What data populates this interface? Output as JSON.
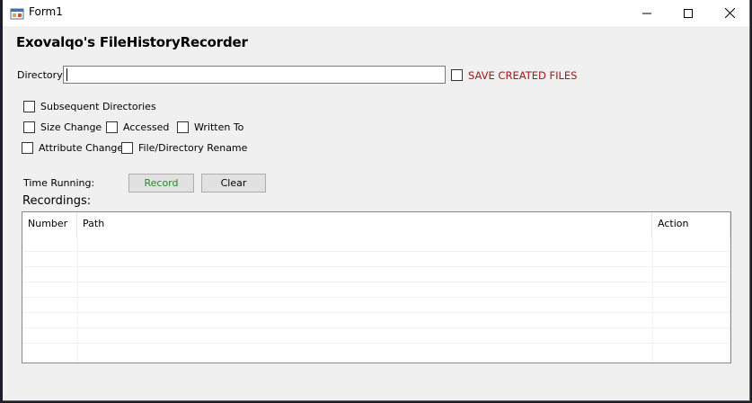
{
  "window": {
    "title": "Form1"
  },
  "app": {
    "heading": "Exovalqo's FileHistoryRecorder"
  },
  "directory": {
    "label": "Directory:",
    "value": ""
  },
  "options": {
    "save_created_files": "SAVE CREATED FILES",
    "subsequent_directories": "Subsequent Directories",
    "size_change": "Size Change",
    "accessed": "Accessed",
    "written_to": "Written To",
    "attribute_change": "Attribute Change",
    "file_directory_rename": "File/Directory Rename"
  },
  "controls": {
    "time_running_label": "Time Running:",
    "record_label": "Record",
    "clear_label": "Clear"
  },
  "recordings": {
    "label": "Recordings:",
    "columns": [
      "Number",
      "Path",
      "Action"
    ]
  },
  "colors": {
    "save_label": "#a0191d",
    "record_text": "#228b22"
  }
}
